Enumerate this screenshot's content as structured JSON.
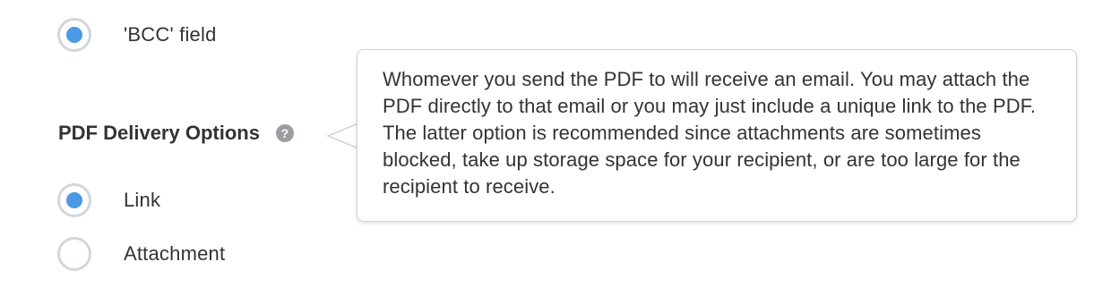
{
  "bcc_option": {
    "label": "'BCC' field",
    "selected": true
  },
  "pdf_delivery": {
    "title": "PDF Delivery Options",
    "help_icon_glyph": "?",
    "help_icon": "question-circle-icon",
    "tooltip_text": "Whomever you send the PDF to will receive an email. You may attach the PDF directly to that email or you may just include a unique link to the PDF. The latter option is recommended since attachments are sometimes blocked, take up storage space for your recipient, or are too large for the recipient to receive.",
    "options": [
      {
        "label": "Link",
        "selected": true
      },
      {
        "label": "Attachment",
        "selected": false
      }
    ]
  },
  "colors": {
    "accent": "#4a9ae6",
    "radio_border": "#d3d6da",
    "text": "#333333",
    "help_icon_bg": "#9a9ea3"
  }
}
